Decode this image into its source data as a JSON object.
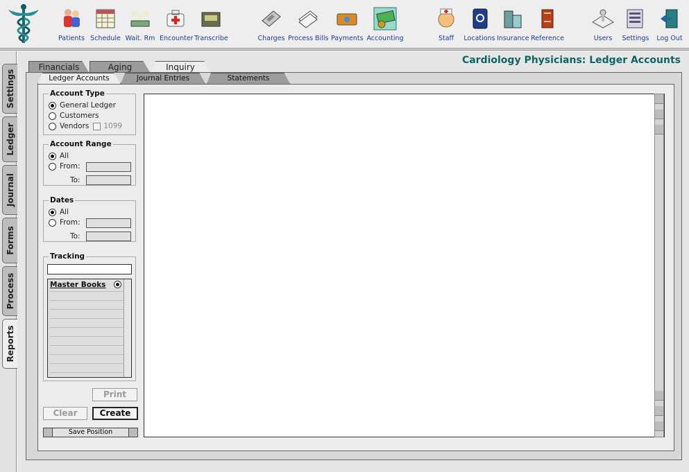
{
  "toolbar": {
    "items": [
      {
        "label": "Patients",
        "icon": "patients-icon"
      },
      {
        "label": "Schedule",
        "icon": "calendar-icon"
      },
      {
        "label": "Wait. Rm",
        "icon": "waiting-room-icon"
      },
      {
        "label": "Encounter",
        "icon": "medical-bag-icon"
      },
      {
        "label": "Transcribe",
        "icon": "transcribe-icon"
      },
      {
        "label": "Charges",
        "icon": "calculator-icon"
      },
      {
        "label": "Process Bills",
        "icon": "bills-icon"
      },
      {
        "label": "Payments",
        "icon": "payment-card-icon"
      },
      {
        "label": "Accounting",
        "icon": "money-icon"
      },
      {
        "label": "Staff",
        "icon": "nurse-icon"
      },
      {
        "label": "Locations",
        "icon": "address-book-icon"
      },
      {
        "label": "Insurance",
        "icon": "building-icon"
      },
      {
        "label": "Reference",
        "icon": "book-icon"
      },
      {
        "label": "Users",
        "icon": "user-icon"
      },
      {
        "label": "Settings",
        "icon": "settings-icon"
      },
      {
        "label": "Log Out",
        "icon": "logout-icon"
      }
    ]
  },
  "side_tabs": [
    "Settings",
    "Ledger",
    "Journal",
    "Forms",
    "Process",
    "Reports"
  ],
  "active_side_tab": "Reports",
  "app_title": "Cardiology Physicians: Ledger Accounts",
  "top_tabs": [
    "Financials",
    "Aging",
    "Inquiry"
  ],
  "active_top_tab": "Inquiry",
  "sub_tabs": [
    "Ledger Accounts",
    "Journal Entries",
    "Statements"
  ],
  "active_sub_tab": "Ledger Accounts",
  "filters": {
    "account_type": {
      "title": "Account Type",
      "options": [
        "General Ledger",
        "Customers",
        "Vendors"
      ],
      "selected": "General Ledger",
      "checkbox_label": "1099"
    },
    "account_range": {
      "title": "Account Range",
      "all_label": "All",
      "from_label": "From:",
      "to_label": "To:",
      "selected": "All"
    },
    "dates": {
      "title": "Dates",
      "all_label": "All",
      "from_label": "From:",
      "to_label": "To:",
      "selected": "All"
    },
    "tracking": {
      "title": "Tracking",
      "list_item": "Master Books"
    }
  },
  "buttons": {
    "print": "Print",
    "clear": "Clear",
    "create": "Create",
    "save_position": "Save Position"
  }
}
